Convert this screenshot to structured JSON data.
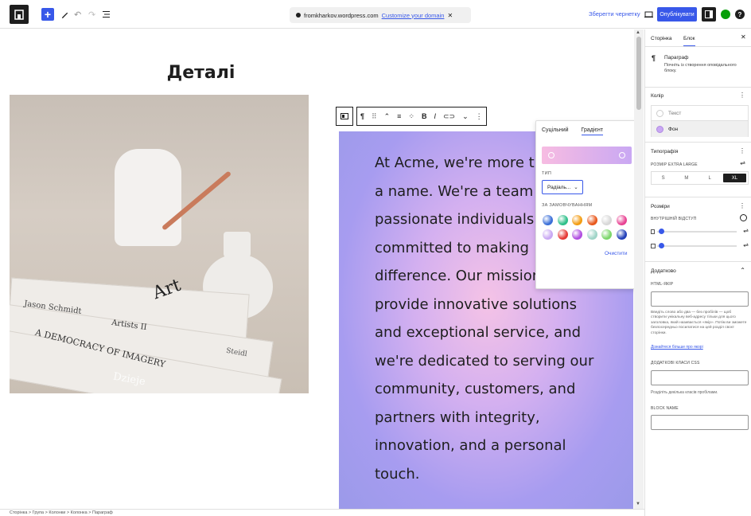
{
  "topbar": {
    "site_url": "fromkharkov.wordpress.com",
    "customize_domain": "Customize your domain",
    "save_draft": "Зберегти чернетку",
    "publish": "Опублікувати"
  },
  "canvas": {
    "page_title": "Деталі",
    "photo_texts": {
      "author": "Jason Schmidt",
      "book1": "Artists II",
      "book2": "A DEMOCRACY OF IMAGERY",
      "publisher": "Steidl",
      "art": "Art",
      "extra": "Dzieje"
    },
    "cover_lines": [
      "At Acme, we're more t",
      "a name. We're a team",
      "passionate individuals",
      "committed to making",
      "difference. Our mission is to",
      "provide innovative solutions",
      "and exceptional service, and",
      "we're dedicated to serving our",
      "community, customers, and",
      "partners with integrity,",
      "innovation, and a personal",
      "touch."
    ]
  },
  "color_popover": {
    "tab_solid": "Суцільний",
    "tab_gradient": "Градієнт",
    "type_label": "ТИП",
    "type_value": "Радіаль...",
    "defaults_label": "ЗА ЗАМОВЧУВАННЯМ",
    "clear": "Очистити",
    "swatches": [
      "#3b6fd8",
      "#2ec08a",
      "#f39c12",
      "#e8581c",
      "#d8d8d8",
      "#e84393",
      "#c9a8f3",
      "#e53935",
      "#b04de0",
      "#9fd4c7",
      "#7bd66a",
      "#2240b8"
    ]
  },
  "sidebar": {
    "tab_page": "Сторінка",
    "tab_block": "Блок",
    "block_name": "Параграф",
    "block_desc": "Почніть із створення оповідального блоку.",
    "color_title": "Колір",
    "color_text": "Текст",
    "color_bg": "Фон",
    "typography_title": "Типографія",
    "size_label": "РОЗМІР EXTRA LARGE",
    "sizes": [
      "S",
      "M",
      "L",
      "XL"
    ],
    "dimensions_title": "Розміри",
    "padding_label": "ВНУТРІШНІЙ ВІДСТУП",
    "advanced_title": "Додатково",
    "anchor_label": "HTML-ЯКІР",
    "anchor_help": "Введіть слово або два — без пробілів — щоб створити унікальну веб-адресу тільки для цього заголовка, який називається «якір». Потім ви зможете безпосередньо посилатися на цей розділ своєї сторінки.",
    "learn_more": "Дізнайтеся більше про якорі",
    "css_label": "ДОДАТКОВІ КЛАСИ CSS",
    "css_help": "Розділіть декілька класів пробілами.",
    "block_name_label": "BLOCK NAME"
  },
  "footer": {
    "breadcrumb": "Сторінка  >  Група  >  Колонки  >  Колонка  >  Параграф"
  }
}
